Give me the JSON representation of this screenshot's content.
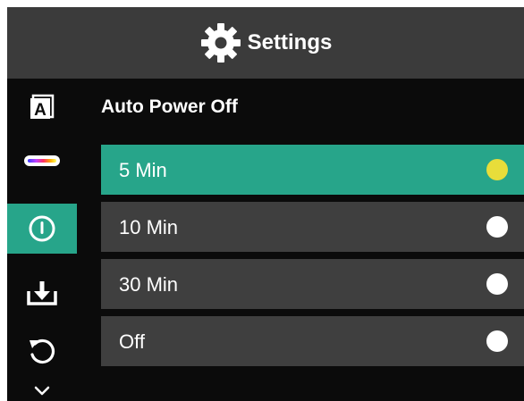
{
  "header": {
    "title": "Settings",
    "icon": "gear-icon"
  },
  "sidebar": {
    "items": [
      {
        "icon": "font-a-icon"
      },
      {
        "icon": "color-palette-bar-icon"
      },
      {
        "icon": "power-icon",
        "active": true
      },
      {
        "icon": "download-tray-icon"
      },
      {
        "icon": "reset-rotate-icon"
      },
      {
        "icon": "chevron-down-icon"
      }
    ]
  },
  "main": {
    "section_title": "Auto Power Off",
    "options": [
      {
        "label": "5 Min",
        "selected": true
      },
      {
        "label": "10 Min",
        "selected": false
      },
      {
        "label": "30 Min",
        "selected": false
      },
      {
        "label": "Off",
        "selected": false
      }
    ]
  },
  "colors": {
    "accent": "#27a58a",
    "selected_indicator": "#e8dd3a",
    "option_background": "#3f3f3f",
    "header_background": "#3b3b3b"
  }
}
